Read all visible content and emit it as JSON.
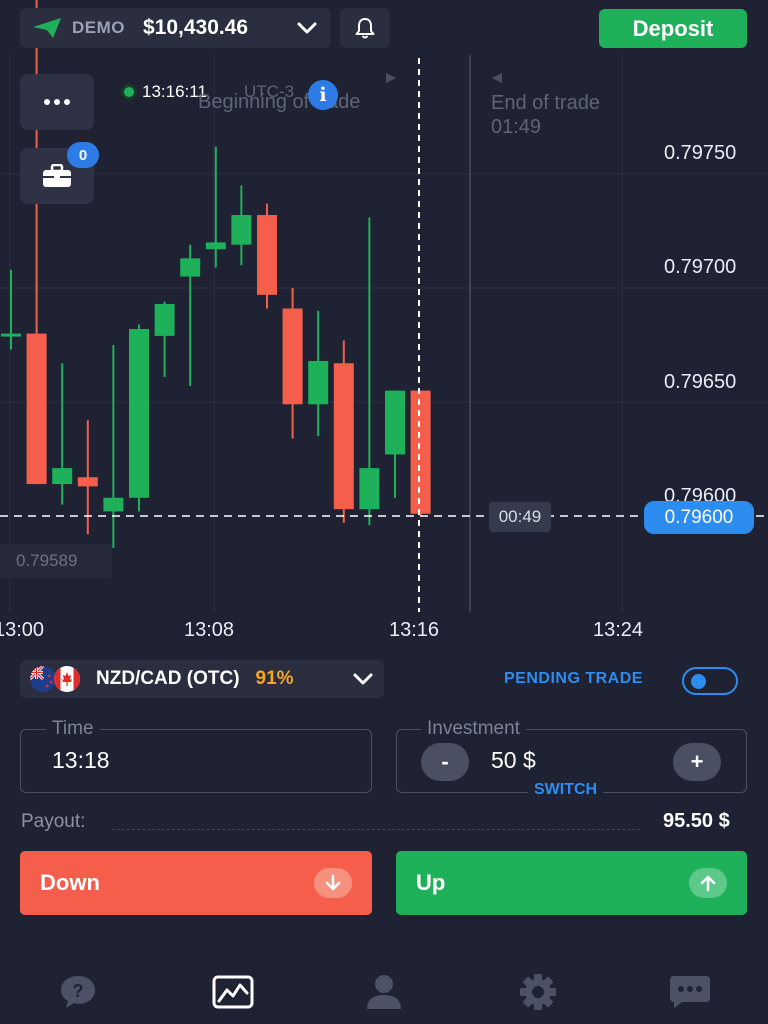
{
  "header": {
    "account_mode": "DEMO",
    "balance": "$10,430.46",
    "deposit_label": "Deposit"
  },
  "chart": {
    "clock_time": "13:16:11",
    "timezone": "UTC-3",
    "info_icon_glyph": "i",
    "begin_label": "Beginning of trade",
    "end_label": "End of trade",
    "end_countdown": "01:49",
    "portfolio_badge": "0",
    "timer": "00:49",
    "current_price": "0.79600",
    "low_price": "0.79589",
    "price_labels": [
      "0.79750",
      "0.79700",
      "0.79650",
      "0.79600"
    ],
    "time_labels": [
      "13:00",
      "13:08",
      "13:16",
      "13:24"
    ]
  },
  "chart_data": {
    "type": "candlestick",
    "title": "",
    "asset": "NZD/CAD (OTC)",
    "y_ticks": [
      0.7975,
      0.797,
      0.7965,
      0.796
    ],
    "x_ticks": [
      "13:00",
      "13:08",
      "13:16",
      "13:24"
    ],
    "current_price": 0.796,
    "grid": true,
    "candles": [
      {
        "o": 0.79679,
        "h": 0.79708,
        "l": 0.79673,
        "c": 0.7968
      },
      {
        "o": 0.7968,
        "h": 0.79827,
        "l": 0.79614,
        "c": 0.79614
      },
      {
        "o": 0.79614,
        "h": 0.79667,
        "l": 0.79605,
        "c": 0.79621
      },
      {
        "o": 0.79617,
        "h": 0.79642,
        "l": 0.79592,
        "c": 0.79613
      },
      {
        "o": 0.79602,
        "h": 0.79675,
        "l": 0.79586,
        "c": 0.79608
      },
      {
        "o": 0.79608,
        "h": 0.79684,
        "l": 0.79602,
        "c": 0.79682
      },
      {
        "o": 0.79679,
        "h": 0.79694,
        "l": 0.79661,
        "c": 0.79693
      },
      {
        "o": 0.79705,
        "h": 0.79719,
        "l": 0.79657,
        "c": 0.79713
      },
      {
        "o": 0.79717,
        "h": 0.79762,
        "l": 0.79709,
        "c": 0.7972
      },
      {
        "o": 0.79719,
        "h": 0.79745,
        "l": 0.7971,
        "c": 0.79732
      },
      {
        "o": 0.79732,
        "h": 0.79737,
        "l": 0.79691,
        "c": 0.79697
      },
      {
        "o": 0.79691,
        "h": 0.797,
        "l": 0.79634,
        "c": 0.79649
      },
      {
        "o": 0.79649,
        "h": 0.7969,
        "l": 0.79635,
        "c": 0.79668
      },
      {
        "o": 0.79667,
        "h": 0.79677,
        "l": 0.79597,
        "c": 0.79603
      },
      {
        "o": 0.79603,
        "h": 0.79731,
        "l": 0.79596,
        "c": 0.79621
      },
      {
        "o": 0.79627,
        "h": 0.79655,
        "l": 0.79608,
        "c": 0.79655
      },
      {
        "o": 0.79655,
        "h": 0.79655,
        "l": 0.796,
        "c": 0.79601
      }
    ]
  },
  "asset": {
    "name": "NZD/CAD (OTC)",
    "payout": "91%",
    "pending_label": "PENDING TRADE"
  },
  "time_field": {
    "legend": "Time",
    "value": "13:18"
  },
  "investment_field": {
    "legend": "Investment",
    "value": "50 $",
    "minus": "-",
    "plus": "+",
    "switch_label": "SWITCH"
  },
  "payout": {
    "label": "Payout:",
    "value": "95.50 $"
  },
  "trade": {
    "down_label": "Down",
    "up_label": "Up"
  },
  "nav": {
    "icons": [
      "help-icon",
      "chart-icon",
      "profile-icon",
      "settings-icon",
      "chat-icon"
    ]
  },
  "colors": {
    "background": "#1f2232",
    "bullish": "#1fb05a",
    "bearish": "#f65e4c",
    "accent": "#2d8cf0",
    "payout": "#f5a623"
  }
}
